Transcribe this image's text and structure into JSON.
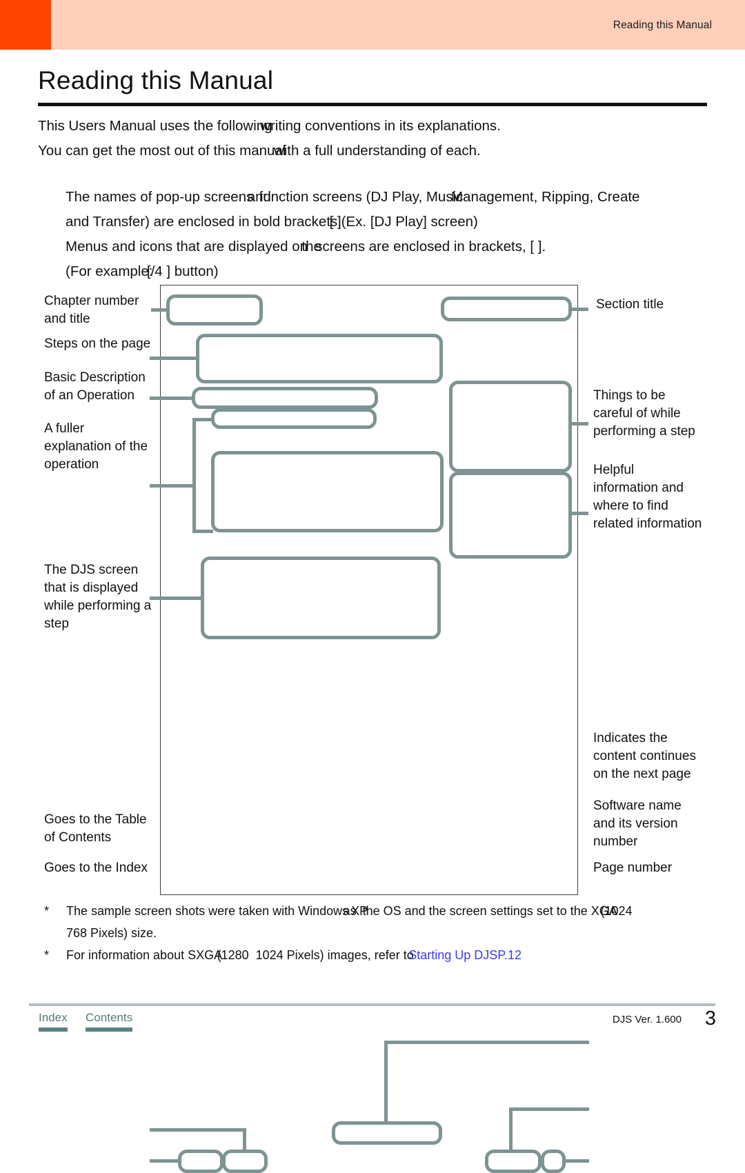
{
  "header": {
    "running_title": "Reading this Manual",
    "accent_color": "#ff4400",
    "band_color": "#ffcfba"
  },
  "page": {
    "title": "Reading this Manual"
  },
  "intro": {
    "line1_a": "This User",
    "line1_b": "s Manual uses the following",
    "line1_c": "writing conventions in its explanations.",
    "line2_a": "You can get the most out of this manual",
    "line2_b": "with a full understanding of each."
  },
  "conventions": {
    "c1_a": "The names of pop-up screens",
    "c1_b": "and",
    "c1_c": "function screens (DJ Play, Music",
    "c1_d": "Management, Ripping, Create",
    "c2_a": "and Transfer) are enclosed in bold brackets,",
    "c2_b": "[ ]",
    "c2_c": "(Ex.",
    "c2_d": "[DJ Play] screen)",
    "c3_a": "Menus and icons that are displayed on",
    "c3_b": "the",
    "c3_c": "screens are enclosed in brackets, [ ].",
    "c4_a": "(For example:",
    "c4_b": "[",
    "c4_c": "/4 ] button)"
  },
  "diagram": {
    "labels_left": [
      {
        "name": "chapter-number-and-title",
        "text": "Chapter number\nand title"
      },
      {
        "name": "steps-on-the-page",
        "text": "Steps on the page"
      },
      {
        "name": "basic-description",
        "text": "Basic Description\nof an Operation"
      },
      {
        "name": "fuller-explanation",
        "text": "A fuller\nexplanation of the\noperation"
      },
      {
        "name": "djs-screen",
        "text": "The DJS screen\nthat is displayed\nwhile performing a\nstep"
      },
      {
        "name": "goes-to-table-of-contents",
        "text": "Goes to the Table\nof Contents"
      },
      {
        "name": "goes-to-the-index",
        "text": "Goes to the Index"
      }
    ],
    "labels_right": [
      {
        "name": "section-title",
        "text": "Section title"
      },
      {
        "name": "things-to-be-careful",
        "text": "Things to be\ncareful of while\nperforming a step"
      },
      {
        "name": "helpful-information",
        "text": "Helpful\ninformation and\nwhere to find\nrelated information"
      },
      {
        "name": "content-continues",
        "text": "Indicates the\ncontent continues\non the next page"
      },
      {
        "name": "software-name-version",
        "text": "Software name\nand its version\nnumber"
      },
      {
        "name": "page-number-label",
        "text": "Page number"
      }
    ],
    "box_border_color": "#7d9493"
  },
  "notes": {
    "star": "*",
    "note1_a": "The sample screen shots were taken with Windows",
    "note1_b": "as",
    "note1_c": "XP",
    "note1_d": "the OS and the screen settings set to the",
    "note1_e": "XGA",
    "note1_f": "(1024",
    "note1_cont": "768 Pixels) size.",
    "note2_a": "For information about SXGA",
    "note2_b": "(1280",
    "note2_c": "1024 Pixels) images, refer to",
    "note2_link": "Starting Up DJS",
    "note2_link_page": "P.12"
  },
  "footer": {
    "tab_index": "Index",
    "tab_contents": "Contents",
    "version": "DJS Ver. 1.600",
    "page_number": "3"
  }
}
